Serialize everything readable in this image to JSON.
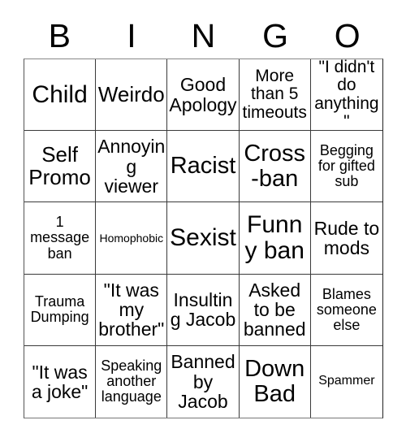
{
  "card": {
    "title_letters": [
      "B",
      "I",
      "N",
      "G",
      "O"
    ],
    "columns": 5,
    "rows": 5,
    "cells": [
      {
        "text": "Child",
        "size": "fs-xxl"
      },
      {
        "text": "Weirdo",
        "size": "fs-lg"
      },
      {
        "text": "Good Apology",
        "size": "fs-md"
      },
      {
        "text": "More than 5 timeouts",
        "size": "fs-sm"
      },
      {
        "text": "\"I didn't do anything\"",
        "size": "fs-sm"
      },
      {
        "text": "Self Promo",
        "size": "fs-lg"
      },
      {
        "text": "Annoying viewer",
        "size": "fs-md"
      },
      {
        "text": "Racist",
        "size": "fs-xl"
      },
      {
        "text": "Cross-ban",
        "size": "fs-xl"
      },
      {
        "text": "Begging for gifted sub",
        "size": "fs-xs"
      },
      {
        "text": "1 message ban",
        "size": "fs-xs"
      },
      {
        "text": "Homophobic",
        "size": "fs-tiny"
      },
      {
        "text": "Sexist",
        "size": "fs-xxl"
      },
      {
        "text": "Funny ban",
        "size": "fs-xxl"
      },
      {
        "text": "Rude to mods",
        "size": "fs-md"
      },
      {
        "text": "Trauma Dumping",
        "size": "fs-xs"
      },
      {
        "text": "\"It was my brother\"",
        "size": "fs-md"
      },
      {
        "text": "Insulting Jacob",
        "size": "fs-md"
      },
      {
        "text": "Asked to be banned",
        "size": "fs-md"
      },
      {
        "text": "Blames someone else",
        "size": "fs-xs"
      },
      {
        "text": "\"It was a joke\"",
        "size": "fs-md"
      },
      {
        "text": "Speaking another language",
        "size": "fs-xs"
      },
      {
        "text": "Banned by Jacob",
        "size": "fs-md"
      },
      {
        "text": "Down Bad",
        "size": "fs-xl"
      },
      {
        "text": "Spammer",
        "size": "fs-xxs"
      }
    ]
  },
  "colors": {
    "background": "#ffffff",
    "text": "#000000",
    "grid_line": "#3a3a3a"
  }
}
